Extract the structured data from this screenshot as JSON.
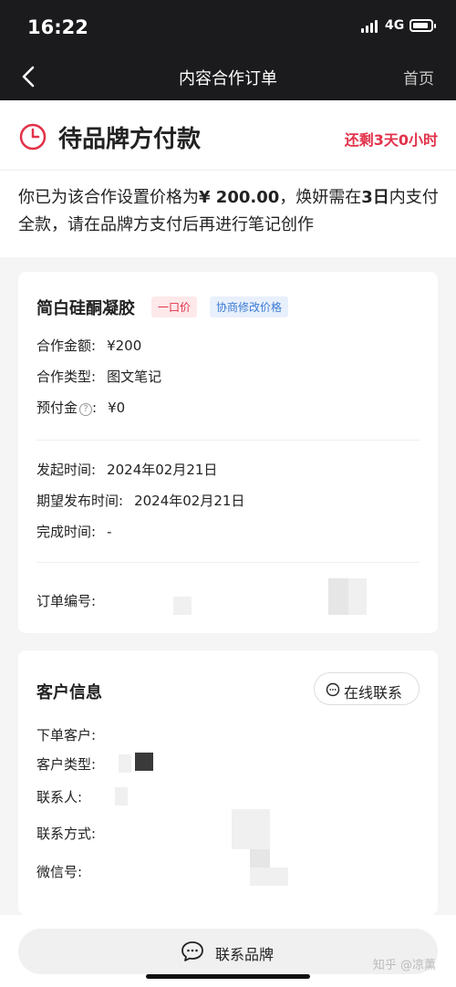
{
  "status_bar": {
    "time": "16:22",
    "network": "4G"
  },
  "nav": {
    "title": "内容合作订单",
    "home_label": "首页"
  },
  "order_state": {
    "title": "待品牌方付款",
    "remaining": "还剩3天0小时",
    "note_part1": "你已为该合作设置价格为",
    "price": "¥ 200.00",
    "note_part2": "，焕妍需在",
    "days": "3日",
    "note_part3": "内支付全款，请在品牌方支付后再进行笔记创作"
  },
  "product": {
    "name": "简白硅酮凝胶",
    "tag_fixed": "一口价",
    "tag_negotiate": "协商修改价格",
    "amount_label": "合作金额:",
    "amount_value": "¥200",
    "type_label": "合作类型:",
    "type_value": "图文笔记",
    "prepay_label": "预付金",
    "prepay_value": "¥0",
    "start_label": "发起时间:",
    "start_value": "2024年02月21日",
    "expect_label": "期望发布时间:",
    "expect_value": "2024年02月21日",
    "finish_label": "完成时间:",
    "finish_value": "-",
    "order_no_label": "订单编号:"
  },
  "customer": {
    "title": "客户信息",
    "contact_online": "在线联系",
    "orderer_label": "下单客户:",
    "type_label": "客户类型:",
    "contact_label": "联系人:",
    "method_label": "联系方式:",
    "wechat_label": "微信号:"
  },
  "bottom": {
    "contact_brand": "联系品牌",
    "watermark": "知乎 @凉薰"
  },
  "colors": {
    "accent_red": "#e2324a",
    "accent_blue": "#3a7ad6",
    "dark_bar": "#1b1b1d"
  },
  "icons": [
    "back-arrow-icon",
    "clock-icon",
    "chat-bubble-icon",
    "help-icon"
  ]
}
